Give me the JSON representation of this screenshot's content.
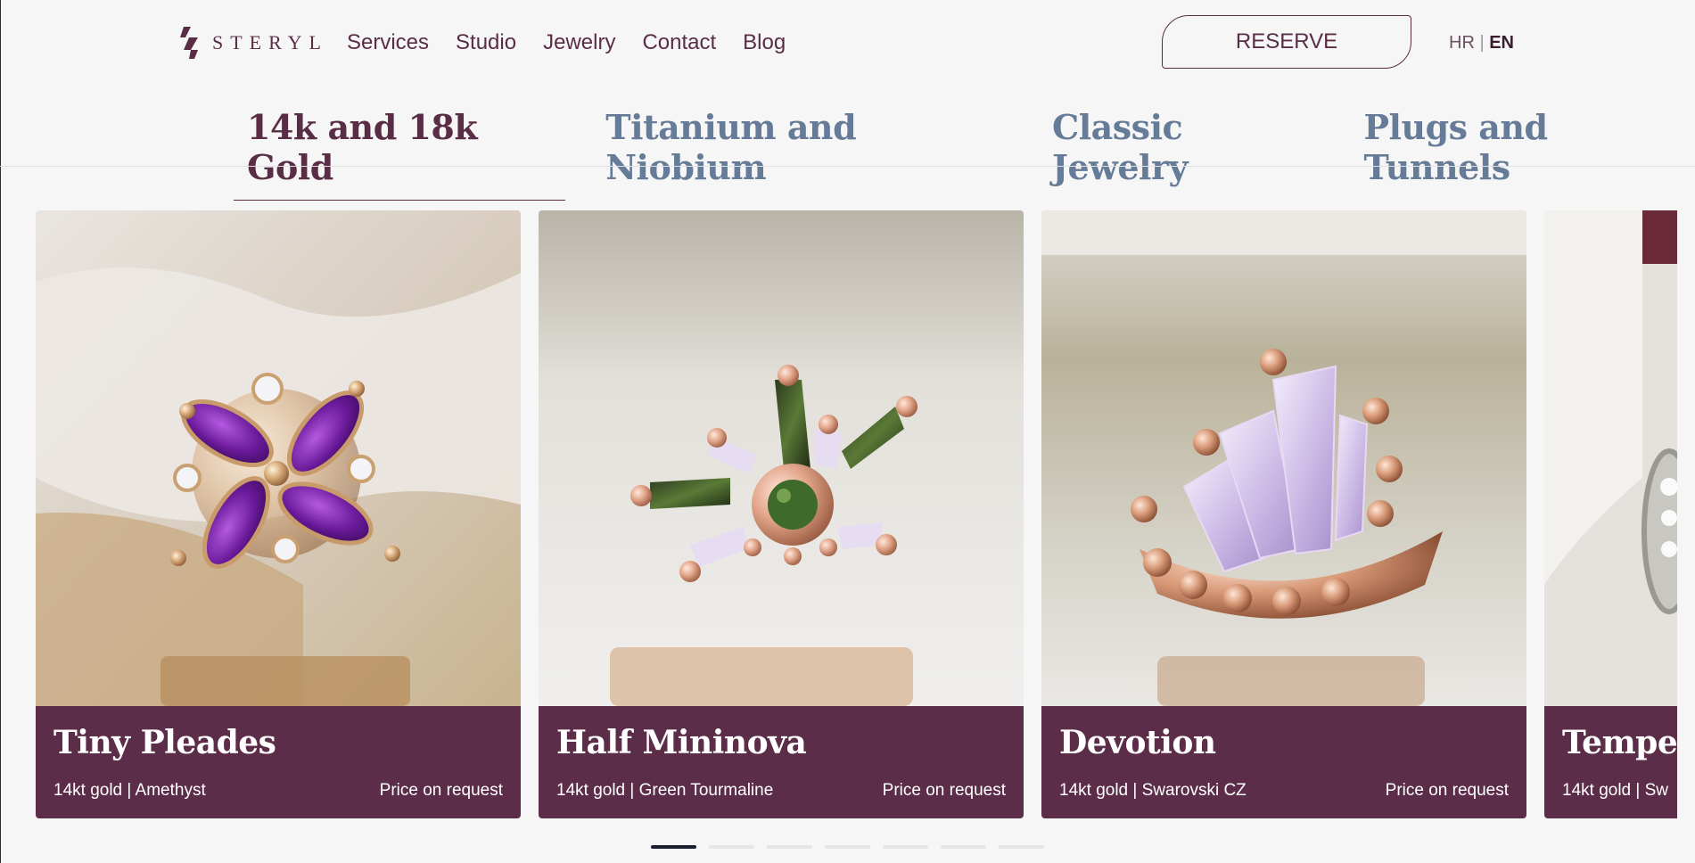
{
  "header": {
    "brand": "STERYL",
    "nav": [
      "Services",
      "Studio",
      "Jewelry",
      "Contact",
      "Blog"
    ],
    "reserve_label": "RESERVE",
    "lang": {
      "hr": "HR",
      "sep": "|",
      "en": "EN",
      "active": "EN"
    }
  },
  "colors": {
    "brand": "#5a2d46",
    "tab_inactive": "#667b97",
    "card_footer": "#5c2d48",
    "background": "#f6f6f6"
  },
  "tabs": [
    "14k and 18k Gold",
    "Titanium and Niobium",
    "Classic Jewelry",
    "Plugs and Tunnels"
  ],
  "active_tab": "14k and 18k Gold",
  "cards": [
    {
      "title": "Tiny Pleades",
      "subtitle": "14kt gold | Amethyst",
      "price": "Price on request",
      "image": "gold-cluster-amethyst-marquise"
    },
    {
      "title": "Half Mininova",
      "subtitle": "14kt gold | Green Tourmaline",
      "price": "Price on request",
      "image": "gold-fan-green-tourmaline"
    },
    {
      "title": "Devotion",
      "subtitle": "14kt gold | Swarovski CZ",
      "price": "Price on request",
      "image": "gold-fan-lavender-cz"
    },
    {
      "title": "Tempes",
      "subtitle": "14kt gold | Sw",
      "price": "",
      "image": "white-gold-partial"
    }
  ],
  "pagination": {
    "total": 7,
    "active": 1
  }
}
